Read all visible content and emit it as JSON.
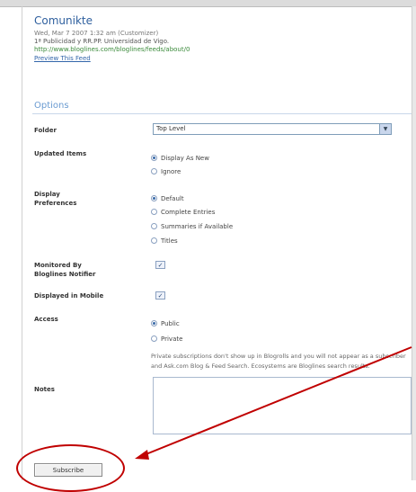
{
  "feed": {
    "title": "Comunikte",
    "date": "Wed, Mar 7 2007 1:32 am (Customizer)",
    "description": "1ª Publicidad y RR.PP. Universidad de Vigo.",
    "url": "http://www.bloglines.com/bloglines/feeds/about/0",
    "preview_link": "Preview This Feed"
  },
  "options": {
    "title": "Options",
    "folder": {
      "label": "Folder",
      "value": "Top Level"
    },
    "updated_items": {
      "label": "Updated Items",
      "choices": [
        {
          "label": "Display As New",
          "selected": true
        },
        {
          "label": "Ignore",
          "selected": false
        }
      ]
    },
    "display_preferences": {
      "label_line1": "Display",
      "label_line2": "Preferences",
      "choices": [
        {
          "label": "Default",
          "selected": true
        },
        {
          "label": "Complete Entries",
          "selected": false
        },
        {
          "label": "Summaries if Available",
          "selected": false
        },
        {
          "label": "Titles",
          "selected": false
        }
      ]
    },
    "monitored": {
      "label_line1": "Monitored By",
      "label_line2": "Bloglines Notifier",
      "check_mark": "✓",
      "checked": true
    },
    "mobile": {
      "label": "Displayed in Mobile",
      "check_mark": "✓",
      "checked": true
    },
    "access": {
      "label": "Access",
      "choices": [
        {
          "label": "Public",
          "selected": true
        },
        {
          "label": "Private",
          "selected": false
        }
      ],
      "note": "Private subscriptions don't show up in Blogrolls and you will not appear as a subscriber and Ask.com Blog & Feed Search. Ecosystems are Bloglines search results."
    },
    "notes": {
      "label": "Notes",
      "value": ""
    }
  },
  "subscribe_button": {
    "label": "Subscribe"
  },
  "annotation": {
    "color": "#c00000"
  }
}
